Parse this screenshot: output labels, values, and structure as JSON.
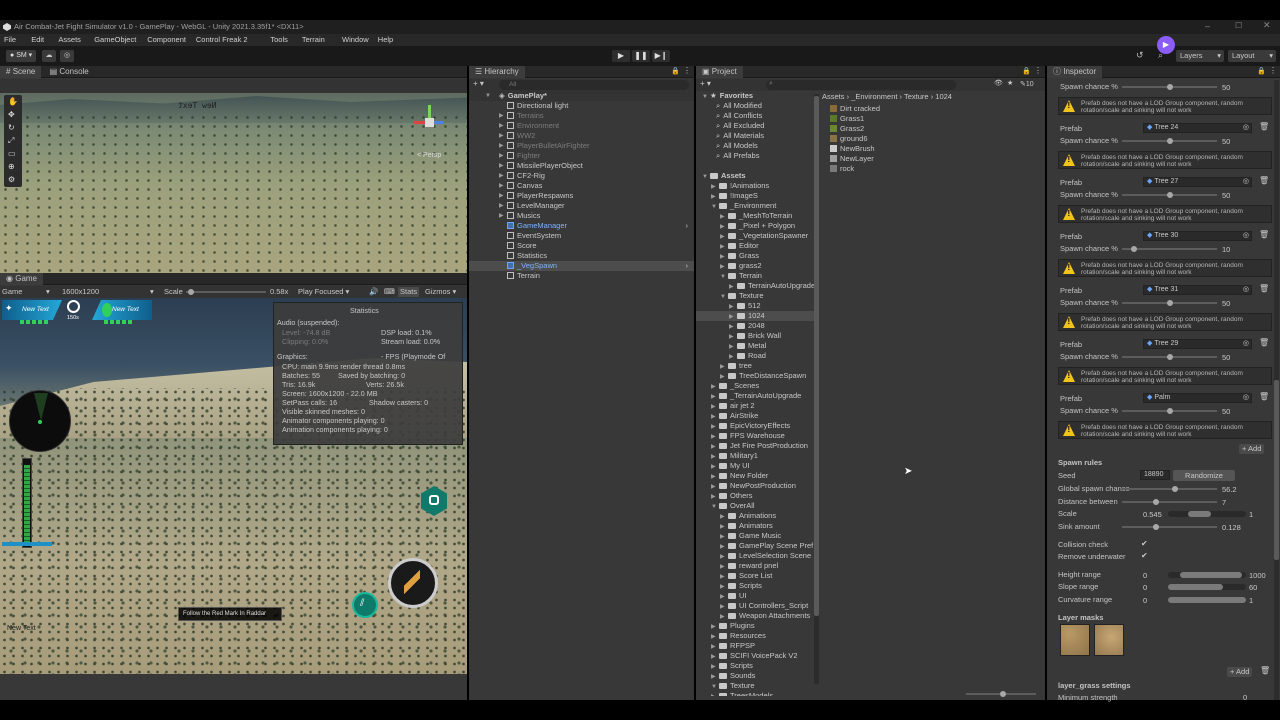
{
  "window": {
    "title": "Air Combat-Jet Fight Simulator v1.0 - GamePlay - WebGL - Unity 2021.3.35f1* <DX11>"
  },
  "menu": [
    "File",
    "Edit",
    "Assets",
    "GameObject",
    "Component",
    "Control Freak 2",
    "Tools",
    "Terrain",
    "Window",
    "Help"
  ],
  "toolbar": {
    "account": "SM",
    "layers": "Layers",
    "layout": "Layout"
  },
  "scene": {
    "tabs": [
      "Scene",
      "Console"
    ],
    "persp_label": "< Persp",
    "scene_text": "New Text"
  },
  "game": {
    "tab": "Game",
    "display": "Game",
    "resolution": "1600x1200",
    "scale_label": "Scale",
    "scale_value": "0.58x",
    "play_mode": "Play Focused",
    "stats_btn": "Stats",
    "gizmos_btn": "Gizmos",
    "hud_left": "New Text",
    "hud_right": "New Text",
    "timer": "150s",
    "objective": "Follow the Red Mark In Raddar",
    "bottom_text": "New Text"
  },
  "stats": {
    "title": "Statistics",
    "audio": "Audio (suspended):",
    "level": "Level: -74.8 dB",
    "dsp": "DSP load: 0.1%",
    "clipping": "Clipping: 0.0%",
    "stream": "Stream load: 0.0%",
    "graphics": "Graphics:",
    "fps": "- FPS (Playmode Of",
    "cpu": "CPU: main 9.9ms  render thread 0.8ms",
    "batches": "Batches: 55",
    "saved": "Saved by batching: 0",
    "tris": "Tris: 16.9k",
    "verts": "Verts: 26.5k",
    "screen": "Screen: 1600x1200 - 22.0 MB",
    "setpass": "SetPass calls: 16",
    "shadow": "Shadow casters: 0",
    "skinned": "Visible skinned meshes: 0",
    "animator": "Animator components playing: 0",
    "animation": "Animation components playing: 0"
  },
  "hierarchy": {
    "tab": "Hierarchy",
    "search": "All",
    "root": "GamePlay*",
    "items": [
      {
        "label": "Directional light",
        "dim": false,
        "blue": false,
        "arrow": false
      },
      {
        "label": "Terrains",
        "dim": true,
        "blue": false,
        "arrow": true
      },
      {
        "label": "Environment",
        "dim": true,
        "blue": false,
        "arrow": true
      },
      {
        "label": "WW2",
        "dim": true,
        "blue": false,
        "arrow": true
      },
      {
        "label": "PlayerBulletAirFighter",
        "dim": true,
        "blue": false,
        "arrow": true
      },
      {
        "label": "Fighter",
        "dim": true,
        "blue": false,
        "arrow": true
      },
      {
        "label": "MissilePlayerObject",
        "dim": false,
        "blue": false,
        "arrow": true
      },
      {
        "label": "CF2-Rig",
        "dim": false,
        "blue": false,
        "arrow": true
      },
      {
        "label": "Canvas",
        "dim": false,
        "blue": false,
        "arrow": true
      },
      {
        "label": "PlayerRespawns",
        "dim": false,
        "blue": false,
        "arrow": true
      },
      {
        "label": "LevelManager",
        "dim": false,
        "blue": false,
        "arrow": true
      },
      {
        "label": "Musics",
        "dim": false,
        "blue": false,
        "arrow": true
      },
      {
        "label": "GameManager",
        "dim": false,
        "blue": true,
        "arrow": false
      },
      {
        "label": "EventSystem",
        "dim": false,
        "blue": false,
        "arrow": false
      },
      {
        "label": "Score",
        "dim": false,
        "blue": false,
        "arrow": false
      },
      {
        "label": "Statistics",
        "dim": false,
        "blue": false,
        "arrow": false
      },
      {
        "label": "_VegSpawn",
        "dim": false,
        "blue": true,
        "arrow": false
      },
      {
        "label": "Terrain",
        "dim": false,
        "blue": false,
        "arrow": false
      }
    ]
  },
  "project": {
    "tab": "Project",
    "count": "10",
    "breadcrumb": [
      "Assets",
      "_Environment",
      "Texture",
      "1024"
    ],
    "favorites_label": "Favorites",
    "favorites": [
      "All Modified",
      "All Conflicts",
      "All Excluded",
      "All Materials",
      "All Models",
      "All Prefabs"
    ],
    "assets_label": "Assets",
    "tree": [
      {
        "label": "!Animations",
        "indent": 1
      },
      {
        "label": "!ImageS",
        "indent": 1
      },
      {
        "label": "_Environment",
        "indent": 1
      },
      {
        "label": "_MeshToTerrain",
        "indent": 2
      },
      {
        "label": "_Pixel + Polygon",
        "indent": 2
      },
      {
        "label": "_VegetationSpawner",
        "indent": 2
      },
      {
        "label": "Editor",
        "indent": 2
      },
      {
        "label": "Grass",
        "indent": 2
      },
      {
        "label": "grass2",
        "indent": 2
      },
      {
        "label": "Terrain",
        "indent": 2
      },
      {
        "label": "TerrainAutoUpgrade",
        "indent": 3
      },
      {
        "label": "Texture",
        "indent": 2
      },
      {
        "label": "512",
        "indent": 3
      },
      {
        "label": "1024",
        "indent": 3
      },
      {
        "label": "2048",
        "indent": 3
      },
      {
        "label": "Brick Wall",
        "indent": 3
      },
      {
        "label": "Metal",
        "indent": 3
      },
      {
        "label": "Road",
        "indent": 3
      },
      {
        "label": "tree",
        "indent": 2
      },
      {
        "label": "TreeDistanceSpawn",
        "indent": 2
      },
      {
        "label": "_Scenes",
        "indent": 1
      },
      {
        "label": "_TerrainAutoUpgrade",
        "indent": 1
      },
      {
        "label": "air jet 2",
        "indent": 1
      },
      {
        "label": "AirStrike",
        "indent": 1
      },
      {
        "label": "EpicVictoryEffects",
        "indent": 1
      },
      {
        "label": "FPS Warehouse",
        "indent": 1
      },
      {
        "label": "Jet Fire PostProduction",
        "indent": 1
      },
      {
        "label": "Military1",
        "indent": 1
      },
      {
        "label": "My UI",
        "indent": 1
      },
      {
        "label": "New Folder",
        "indent": 1
      },
      {
        "label": "NewPostProduction",
        "indent": 1
      },
      {
        "label": "Others",
        "indent": 1
      },
      {
        "label": "OverAll",
        "indent": 1
      },
      {
        "label": "Animations",
        "indent": 2
      },
      {
        "label": "Animators",
        "indent": 2
      },
      {
        "label": "Game Music",
        "indent": 2
      },
      {
        "label": "GamePlay Scene Pref",
        "indent": 2
      },
      {
        "label": "LevelSelection Scene",
        "indent": 2
      },
      {
        "label": "reward pnel",
        "indent": 2
      },
      {
        "label": "Score List",
        "indent": 2
      },
      {
        "label": "Scripts",
        "indent": 2
      },
      {
        "label": "UI",
        "indent": 2
      },
      {
        "label": "UI Controllers_Script",
        "indent": 2
      },
      {
        "label": "Weapon Attachments",
        "indent": 2
      },
      {
        "label": "Plugins",
        "indent": 1
      },
      {
        "label": "Resources",
        "indent": 1
      },
      {
        "label": "RFPSP",
        "indent": 1
      },
      {
        "label": "SCIFI VoicePack V2",
        "indent": 1
      },
      {
        "label": "Scripts",
        "indent": 1
      },
      {
        "label": "Sounds",
        "indent": 1
      },
      {
        "label": "Texture",
        "indent": 1
      },
      {
        "label": "TreesModels",
        "indent": 1
      }
    ],
    "files": [
      {
        "label": "Dirt cracked",
        "color": "#8a6a3a"
      },
      {
        "label": "Grass1",
        "color": "#5a7a2a"
      },
      {
        "label": "Grass2",
        "color": "#6b8a30"
      },
      {
        "label": "ground6",
        "color": "#8b7345"
      },
      {
        "label": "NewBrush",
        "color": "#cccccc"
      },
      {
        "label": "NewLayer",
        "color": "#a0a0a0"
      },
      {
        "label": "rock",
        "color": "#7a7a7a"
      }
    ]
  },
  "inspector": {
    "tab": "Inspector",
    "warning": "Prefab does not have a LOD Group component, random rotation/scale and sinking will not work",
    "spawn_label": "Spawn chance %",
    "prefab_label": "Prefab",
    "top_value": "50",
    "prefabs": [
      {
        "name": "Tree 24",
        "value": "50",
        "pct": 0.5
      },
      {
        "name": "Tree 27",
        "value": "50",
        "pct": 0.5
      },
      {
        "name": "Tree 30",
        "value": "10",
        "pct": 0.1
      },
      {
        "name": "Tree 31",
        "value": "50",
        "pct": 0.5
      },
      {
        "name": "Tree 29",
        "value": "50",
        "pct": 0.5
      },
      {
        "name": "Palm",
        "value": "50",
        "pct": 0.5
      }
    ],
    "add_btn": "+ Add",
    "spawn_rules": "Spawn rules",
    "seed_label": "Seed",
    "seed_value": "18890",
    "randomize": "Randomize",
    "global_label": "Global spawn chance",
    "global_value": "56.2",
    "distance_label": "Distance between",
    "distance_value": "7",
    "scale_label": "Scale",
    "scale_min": "0.545",
    "scale_max": "1",
    "sink_label": "Sink amount",
    "sink_value": "0.128",
    "collision_label": "Collision check",
    "underwater_label": "Remove underwater",
    "height_label": "Height range",
    "height_min": "0",
    "height_max": "1000",
    "slope_label": "Slope range",
    "slope_min": "0",
    "slope_max": "60",
    "curv_label": "Curvature range",
    "curv_min": "0",
    "curv_max": "1",
    "layer_masks": "Layer masks",
    "layer_grass": "layer_grass settings",
    "min_strength": "Minimum strength",
    "min_strength_value": "0"
  }
}
